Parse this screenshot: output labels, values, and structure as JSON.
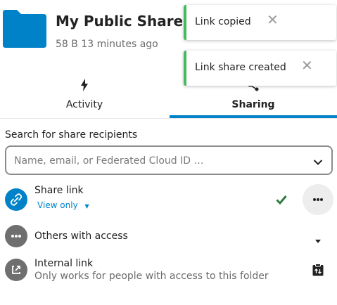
{
  "header": {
    "title": "My Public Shared F",
    "meta": "58 B 13 minutes ago"
  },
  "toasts": [
    {
      "message": "Link copied",
      "close": "✕"
    },
    {
      "message": "Link share created",
      "close": "✕"
    }
  ],
  "tabs": [
    {
      "label": "Activity",
      "icon": "activity-icon"
    },
    {
      "label": "Sharing",
      "icon": "share-icon",
      "active": true
    }
  ],
  "search": {
    "label": "Search for share recipients",
    "placeholder": "Name, email, or Federated Cloud ID …"
  },
  "share_link": {
    "title": "Share link",
    "permission": "View only",
    "permission_caret": "▼",
    "status_icon": "check-icon"
  },
  "others": {
    "title": "Others with access"
  },
  "internal": {
    "title": "Internal link",
    "subtitle": "Only works for people with access to this folder"
  },
  "colors": {
    "accent": "#0082c9",
    "toast_success": "#46ba61",
    "check": "#2d7b41"
  }
}
